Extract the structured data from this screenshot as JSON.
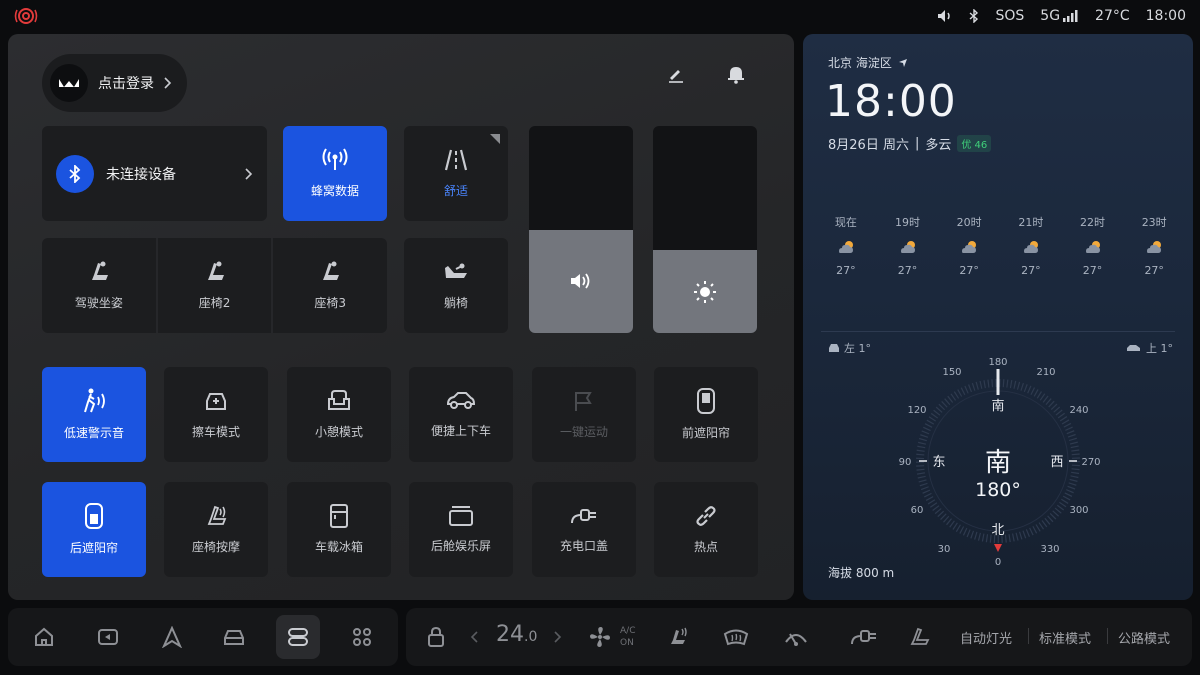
{
  "status_bar": {
    "sos": "SOS",
    "network": "5G",
    "temperature": "27°C",
    "time": "18:00"
  },
  "control_panel": {
    "login_label": "点击登录",
    "bluetooth_label": "未连接设备",
    "cellular_label": "蜂窝数据",
    "comfort_label": "舒适",
    "seats": [
      "驾驶坐姿",
      "座椅2",
      "座椅3"
    ],
    "recline_label": "躺椅",
    "volume_level": 0.5,
    "brightness_level": 0.4,
    "row1": [
      "低速警示音",
      "擦车模式",
      "小憩模式",
      "便捷上下车",
      "一键运动",
      "前遮阳帘"
    ],
    "row2": [
      "后遮阳帘",
      "座椅按摩",
      "车载冰箱",
      "后舱娱乐屏",
      "充电口盖",
      "热点"
    ]
  },
  "weather": {
    "location": "北京 海淀区",
    "time": "18:00",
    "date": "8月26日 周六",
    "condition": "多云",
    "aqi": "优 46",
    "hourly": [
      {
        "hour": "现在",
        "temp": "27°"
      },
      {
        "hour": "19时",
        "temp": "27°"
      },
      {
        "hour": "20时",
        "temp": "27°"
      },
      {
        "hour": "21时",
        "temp": "27°"
      },
      {
        "hour": "22时",
        "temp": "27°"
      },
      {
        "hour": "23时",
        "temp": "27°"
      }
    ],
    "left_tilt": "左 1°",
    "right_tilt": "上 1°",
    "compass": {
      "direction": "南",
      "heading": "180°",
      "cardinal_s": "南",
      "cardinal_e": "东",
      "cardinal_w": "西",
      "cardinal_n": "北",
      "ticks": [
        "180",
        "210",
        "240",
        "270",
        "300",
        "330",
        "0",
        "30",
        "60",
        "90",
        "120",
        "150"
      ]
    },
    "altitude": "海拔 800 m"
  },
  "dock": {
    "temperature": "24.0",
    "ac_top": "A/C",
    "ac_bottom": "ON",
    "auto_light": "自动灯光",
    "standard_mode": "标准模式",
    "road_mode": "公路模式"
  },
  "colors": {
    "accent": "#1b54e0",
    "comfort_text": "#4a86ff",
    "aqi_green": "#3fd07a",
    "compass_pointer": "#e23b3b"
  }
}
